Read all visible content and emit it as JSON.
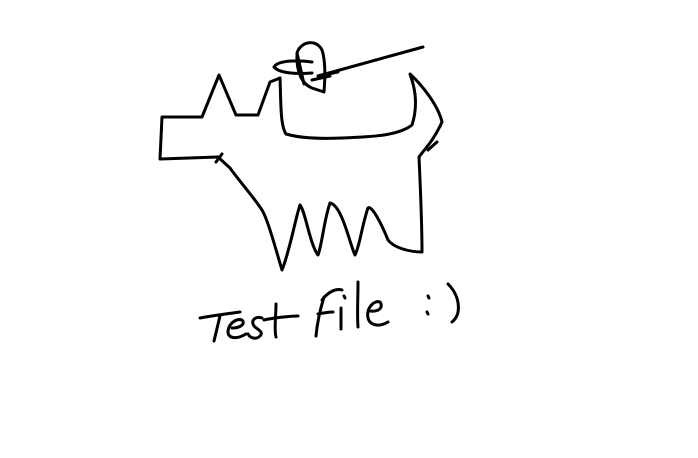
{
  "caption": "Test File :)",
  "colors": {
    "background": "#ffffff",
    "ink": "#000000"
  }
}
